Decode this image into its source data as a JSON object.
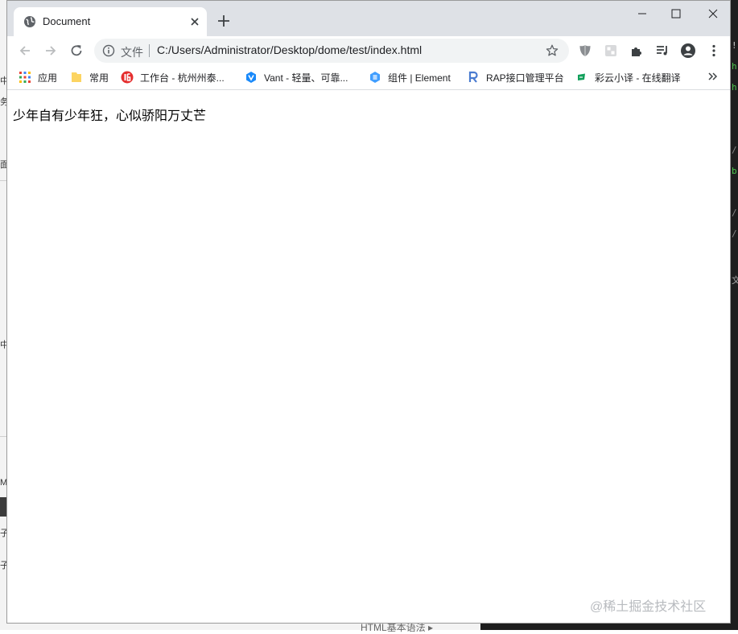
{
  "background": {
    "left_fragments": [
      "中",
      "务",
      "面",
      "中",
      "M",
      "",
      "子",
      "子"
    ],
    "right_fragments": [
      "!",
      "h",
      "h",
      "/",
      "b",
      "/",
      "/",
      "文"
    ],
    "bottom_fragment": "HTML基本语法 ▸"
  },
  "browser": {
    "tab": {
      "title": "Document",
      "favicon": "globe-icon"
    },
    "window_controls": [
      "minimize-icon",
      "maximize-icon",
      "close-icon"
    ],
    "address_bar": {
      "scheme_label": "文件",
      "url": "C:/Users/Administrator/Desktop/dome/test/index.html"
    },
    "bookmarks": [
      {
        "label": "应用",
        "icon": "apps-grid-icon"
      },
      {
        "label": "常用",
        "icon": "folder-icon"
      },
      {
        "label": "工作台 - 杭州州泰...",
        "icon": "workbench-icon"
      },
      {
        "label": "Vant - 轻量、可靠...",
        "icon": "vant-icon"
      },
      {
        "label": "组件 | Element",
        "icon": "element-icon"
      },
      {
        "label": "RAP接口管理平台",
        "icon": "rap-icon"
      },
      {
        "label": "彩云小译 - 在线翻译",
        "icon": "caiyun-icon"
      }
    ],
    "accent": "#1a73e8",
    "tabstrip_color": "#dee1e6"
  },
  "page": {
    "body_text": "少年自有少年狂，心似骄阳万丈芒"
  },
  "watermark": "@稀土掘金技术社区"
}
